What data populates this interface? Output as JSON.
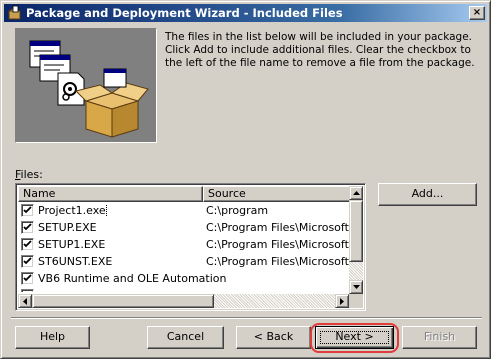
{
  "window": {
    "title": "Package and Deployment Wizard - Included Files",
    "close_glyph": "×"
  },
  "description": "The files in the list below will be included in your package. Click Add to include additional files. Clear the checkbox to the left of the file name to remove a file from the package.",
  "files_label": {
    "accel": "F",
    "rest": "iles:"
  },
  "list": {
    "columns": [
      "Name",
      "Source"
    ],
    "rows": [
      {
        "name": "Project1.exe",
        "source": "C:\\program",
        "checked": true
      },
      {
        "name": "SETUP.EXE",
        "source": "C:\\Program Files\\Microsoft Visu",
        "checked": true
      },
      {
        "name": "SETUP1.EXE",
        "source": "C:\\Program Files\\Microsoft Visu",
        "checked": true
      },
      {
        "name": "ST6UNST.EXE",
        "source": "C:\\Program Files\\Microsoft Visu",
        "checked": true
      },
      {
        "name": "VB6 Runtime and OLE Automation",
        "source": "",
        "checked": true
      }
    ]
  },
  "buttons": {
    "add": "Add...",
    "help": "Help",
    "cancel": "Cancel",
    "back": "< Back",
    "next": "Next >",
    "finish": "Finish"
  },
  "colors": {
    "title_bar": "#0a246a",
    "window_face": "#d4d0c8",
    "annotation_ring": "#e03c3c"
  },
  "icons": [
    "app-icon",
    "close-icon",
    "package-illustration",
    "check-icon",
    "arrow-up-icon",
    "arrow-down-icon",
    "arrow-left-icon",
    "arrow-right-icon"
  ]
}
